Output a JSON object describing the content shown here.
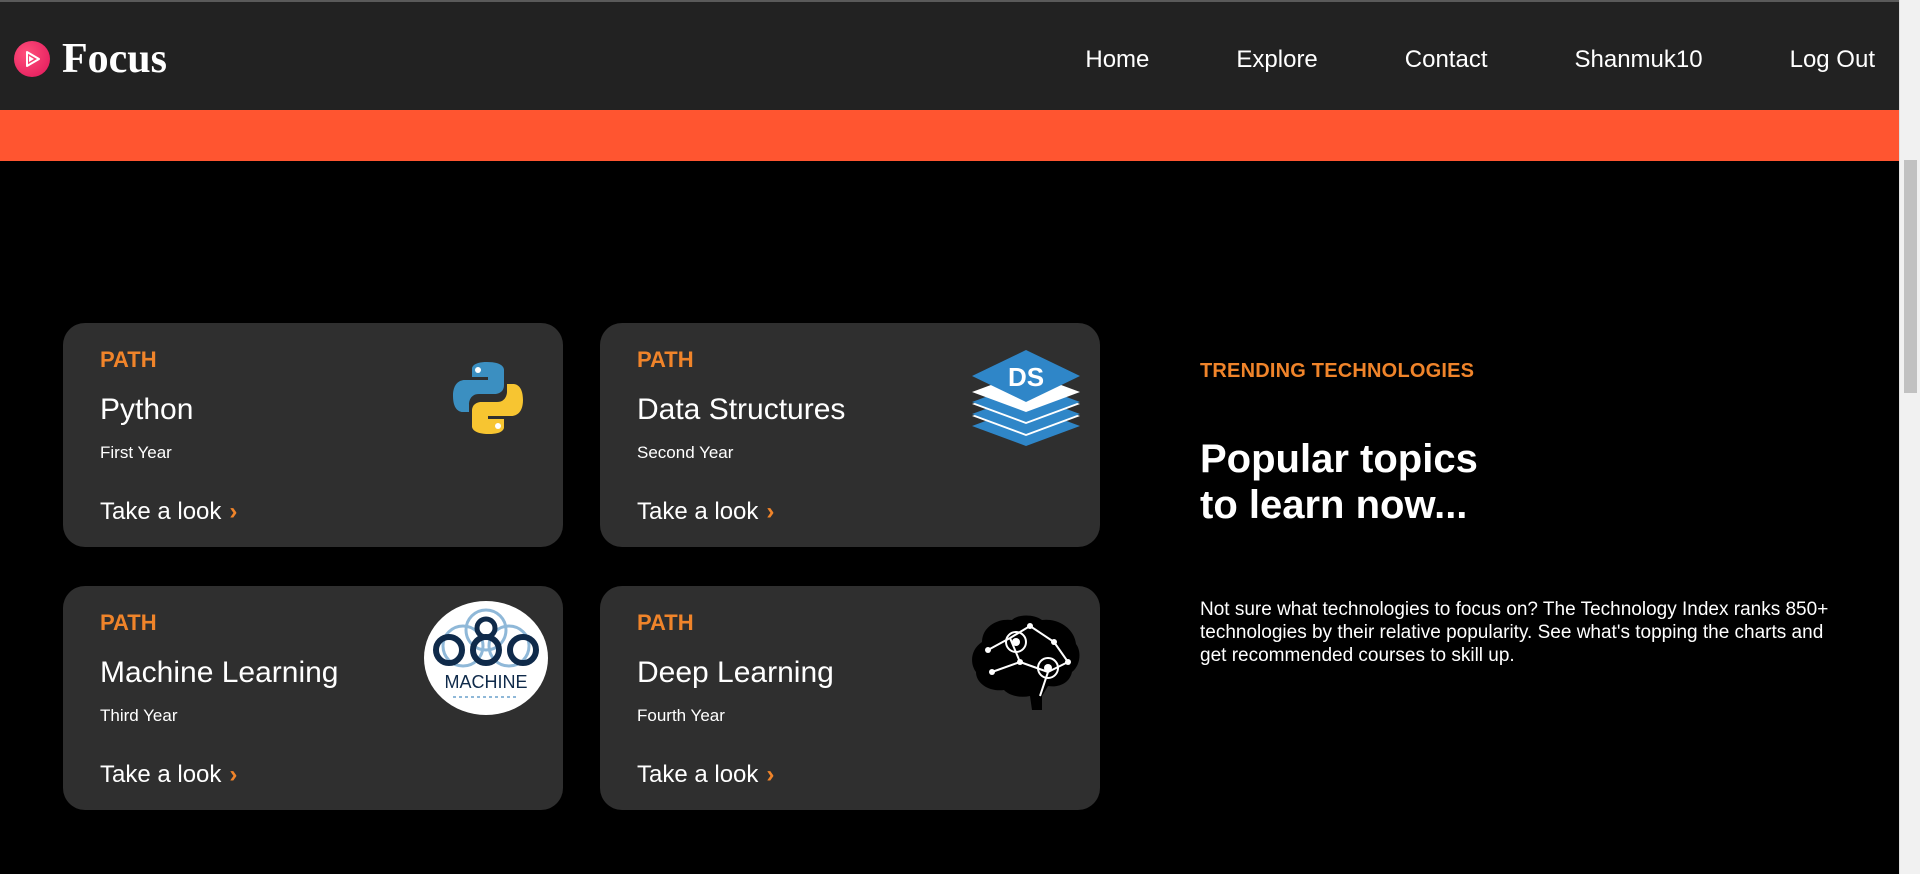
{
  "nav": {
    "brand": "Focus",
    "links": [
      "Home",
      "Explore",
      "Contact",
      "Shanmuk10",
      "Log Out"
    ]
  },
  "cards": [
    {
      "tag": "PATH",
      "title": "Python",
      "subtitle": "First Year",
      "link": "Take a look",
      "icon": "python-logo-icon"
    },
    {
      "tag": "PATH",
      "title": "Data Structures",
      "subtitle": "Second Year",
      "link": "Take a look",
      "icon": "ds-stack-icon",
      "icon_text": "DS"
    },
    {
      "tag": "PATH",
      "title": "Machine Learning",
      "subtitle": "Third Year",
      "link": "Take a look",
      "icon": "machine-learning-logo-icon",
      "icon_text": "MACHINE"
    },
    {
      "tag": "PATH",
      "title": "Deep Learning",
      "subtitle": "Fourth Year",
      "link": "Take a look",
      "icon": "brain-gears-icon"
    }
  ],
  "trending": {
    "label": "TRENDING TECHNOLOGIES",
    "headline_line1": "Popular topics",
    "headline_line2": "to learn now...",
    "blurb": "Not sure what technologies to focus on? The Technology Index ranks 850+ technologies by their relative popularity. See what's topping the charts and get recommended courses to skill up."
  },
  "colors": {
    "navbar": "#222222",
    "band": "#ff5530",
    "accent": "#f0842a",
    "card": "#2f2f2f"
  }
}
